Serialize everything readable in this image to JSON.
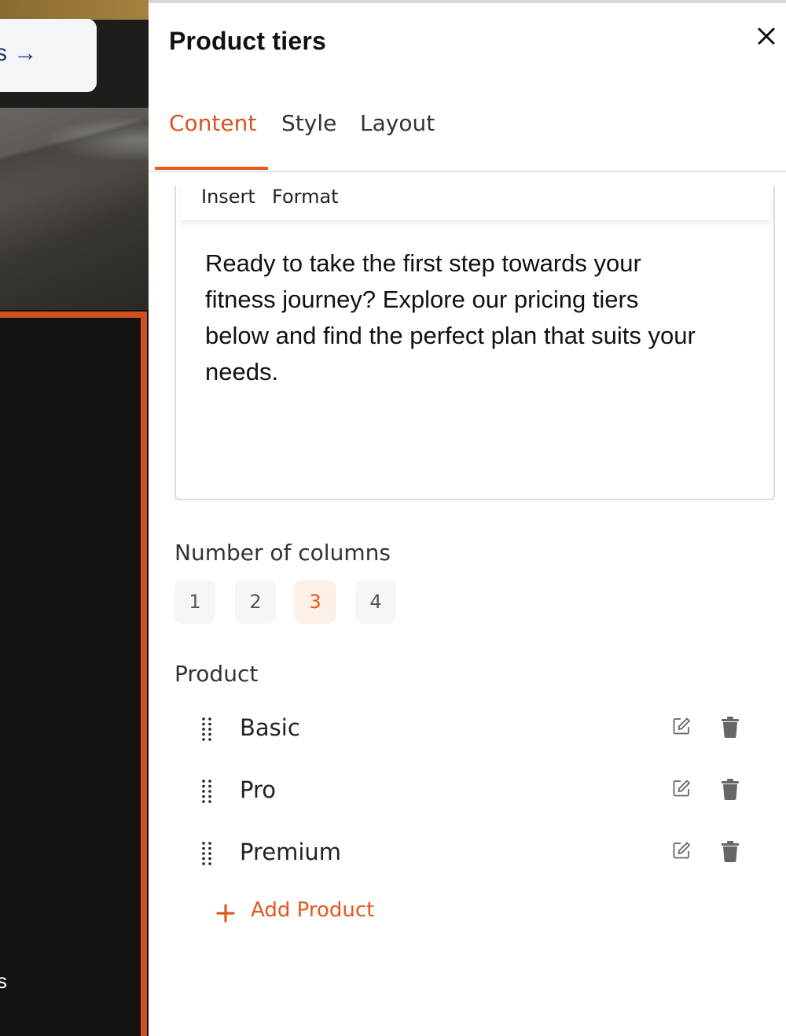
{
  "preview": {
    "cta_text": "s →",
    "bottom_text": "s"
  },
  "panel": {
    "title": "Product tiers",
    "close_icon": "close-icon",
    "tabs": [
      {
        "label": "Content",
        "active": true
      },
      {
        "label": "Style",
        "active": false
      },
      {
        "label": "Layout",
        "active": false
      }
    ]
  },
  "editor": {
    "menu": [
      "Insert",
      "Format"
    ],
    "body": "Ready to take the first step towards your fitness journey? Explore our pricing tiers below and find the perfect plan that suits your needs."
  },
  "columns": {
    "label": "Number of columns",
    "options": [
      "1",
      "2",
      "3",
      "4"
    ],
    "selected": "3"
  },
  "products": {
    "label": "Product",
    "items": [
      {
        "name": "Basic"
      },
      {
        "name": "Pro"
      },
      {
        "name": "Premium"
      }
    ],
    "add_label": "Add Product"
  },
  "colors": {
    "accent": "#e2571c",
    "frame": "#d0511d",
    "preview_bg": "#121212"
  }
}
